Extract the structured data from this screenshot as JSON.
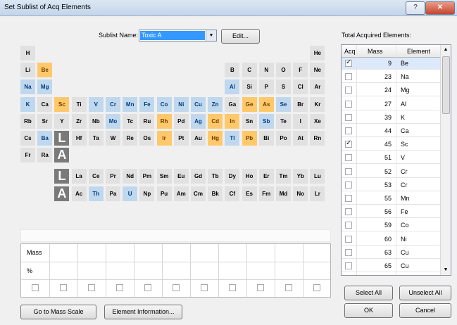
{
  "window": {
    "title": "Set Sublist of Acq Elements",
    "help": "?",
    "close": "✕"
  },
  "sublist": {
    "label": "Sublist Name:",
    "value": "Toxic A",
    "edit_button": "Edit..."
  },
  "total_label": "Total Acquired Elements:",
  "periodic_table": {
    "colors": {
      "normal": "#e1e1e1",
      "blue": "#c0d8ee",
      "orange": "#ffc96b",
      "gray": "#7a7a7a"
    },
    "elements": [
      {
        "s": "H",
        "r": 0,
        "c": 0,
        "k": "n"
      },
      {
        "s": "He",
        "r": 0,
        "c": 17,
        "k": "n"
      },
      {
        "s": "Li",
        "r": 1,
        "c": 0,
        "k": "n"
      },
      {
        "s": "Be",
        "r": 1,
        "c": 1,
        "k": "o"
      },
      {
        "s": "B",
        "r": 1,
        "c": 12,
        "k": "n"
      },
      {
        "s": "C",
        "r": 1,
        "c": 13,
        "k": "n"
      },
      {
        "s": "N",
        "r": 1,
        "c": 14,
        "k": "n"
      },
      {
        "s": "O",
        "r": 1,
        "c": 15,
        "k": "n"
      },
      {
        "s": "F",
        "r": 1,
        "c": 16,
        "k": "n"
      },
      {
        "s": "Ne",
        "r": 1,
        "c": 17,
        "k": "n"
      },
      {
        "s": "Na",
        "r": 2,
        "c": 0,
        "k": "b"
      },
      {
        "s": "Mg",
        "r": 2,
        "c": 1,
        "k": "b"
      },
      {
        "s": "Al",
        "r": 2,
        "c": 12,
        "k": "b"
      },
      {
        "s": "Si",
        "r": 2,
        "c": 13,
        "k": "n"
      },
      {
        "s": "P",
        "r": 2,
        "c": 14,
        "k": "n"
      },
      {
        "s": "S",
        "r": 2,
        "c": 15,
        "k": "n"
      },
      {
        "s": "Cl",
        "r": 2,
        "c": 16,
        "k": "n"
      },
      {
        "s": "Ar",
        "r": 2,
        "c": 17,
        "k": "n"
      },
      {
        "s": "K",
        "r": 3,
        "c": 0,
        "k": "b"
      },
      {
        "s": "Ca",
        "r": 3,
        "c": 1,
        "k": "n"
      },
      {
        "s": "Sc",
        "r": 3,
        "c": 2,
        "k": "o"
      },
      {
        "s": "Ti",
        "r": 3,
        "c": 3,
        "k": "n"
      },
      {
        "s": "V",
        "r": 3,
        "c": 4,
        "k": "b"
      },
      {
        "s": "Cr",
        "r": 3,
        "c": 5,
        "k": "b"
      },
      {
        "s": "Mn",
        "r": 3,
        "c": 6,
        "k": "b"
      },
      {
        "s": "Fe",
        "r": 3,
        "c": 7,
        "k": "b"
      },
      {
        "s": "Co",
        "r": 3,
        "c": 8,
        "k": "b"
      },
      {
        "s": "Ni",
        "r": 3,
        "c": 9,
        "k": "b"
      },
      {
        "s": "Cu",
        "r": 3,
        "c": 10,
        "k": "b"
      },
      {
        "s": "Zn",
        "r": 3,
        "c": 11,
        "k": "b"
      },
      {
        "s": "Ga",
        "r": 3,
        "c": 12,
        "k": "n"
      },
      {
        "s": "Ge",
        "r": 3,
        "c": 13,
        "k": "o"
      },
      {
        "s": "As",
        "r": 3,
        "c": 14,
        "k": "o"
      },
      {
        "s": "Se",
        "r": 3,
        "c": 15,
        "k": "b"
      },
      {
        "s": "Br",
        "r": 3,
        "c": 16,
        "k": "n"
      },
      {
        "s": "Kr",
        "r": 3,
        "c": 17,
        "k": "n"
      },
      {
        "s": "Rb",
        "r": 4,
        "c": 0,
        "k": "n"
      },
      {
        "s": "Sr",
        "r": 4,
        "c": 1,
        "k": "n"
      },
      {
        "s": "Y",
        "r": 4,
        "c": 2,
        "k": "n"
      },
      {
        "s": "Zr",
        "r": 4,
        "c": 3,
        "k": "n"
      },
      {
        "s": "Nb",
        "r": 4,
        "c": 4,
        "k": "n"
      },
      {
        "s": "Mo",
        "r": 4,
        "c": 5,
        "k": "b"
      },
      {
        "s": "Tc",
        "r": 4,
        "c": 6,
        "k": "n"
      },
      {
        "s": "Ru",
        "r": 4,
        "c": 7,
        "k": "n"
      },
      {
        "s": "Rh",
        "r": 4,
        "c": 8,
        "k": "o"
      },
      {
        "s": "Pd",
        "r": 4,
        "c": 9,
        "k": "n"
      },
      {
        "s": "Ag",
        "r": 4,
        "c": 10,
        "k": "b"
      },
      {
        "s": "Cd",
        "r": 4,
        "c": 11,
        "k": "o"
      },
      {
        "s": "In",
        "r": 4,
        "c": 12,
        "k": "o"
      },
      {
        "s": "Sn",
        "r": 4,
        "c": 13,
        "k": "n"
      },
      {
        "s": "Sb",
        "r": 4,
        "c": 14,
        "k": "b"
      },
      {
        "s": "Te",
        "r": 4,
        "c": 15,
        "k": "n"
      },
      {
        "s": "I",
        "r": 4,
        "c": 16,
        "k": "n"
      },
      {
        "s": "Xe",
        "r": 4,
        "c": 17,
        "k": "n"
      },
      {
        "s": "Cs",
        "r": 5,
        "c": 0,
        "k": "n"
      },
      {
        "s": "Ba",
        "r": 5,
        "c": 1,
        "k": "b"
      },
      {
        "s": "L",
        "r": 5,
        "c": 2,
        "k": "g"
      },
      {
        "s": "Hf",
        "r": 5,
        "c": 3,
        "k": "n"
      },
      {
        "s": "Ta",
        "r": 5,
        "c": 4,
        "k": "n"
      },
      {
        "s": "W",
        "r": 5,
        "c": 5,
        "k": "n"
      },
      {
        "s": "Re",
        "r": 5,
        "c": 6,
        "k": "n"
      },
      {
        "s": "Os",
        "r": 5,
        "c": 7,
        "k": "n"
      },
      {
        "s": "Ir",
        "r": 5,
        "c": 8,
        "k": "o"
      },
      {
        "s": "Pt",
        "r": 5,
        "c": 9,
        "k": "n"
      },
      {
        "s": "Au",
        "r": 5,
        "c": 10,
        "k": "n"
      },
      {
        "s": "Hg",
        "r": 5,
        "c": 11,
        "k": "o"
      },
      {
        "s": "Tl",
        "r": 5,
        "c": 12,
        "k": "b"
      },
      {
        "s": "Pb",
        "r": 5,
        "c": 13,
        "k": "o"
      },
      {
        "s": "Bi",
        "r": 5,
        "c": 14,
        "k": "n"
      },
      {
        "s": "Po",
        "r": 5,
        "c": 15,
        "k": "n"
      },
      {
        "s": "At",
        "r": 5,
        "c": 16,
        "k": "n"
      },
      {
        "s": "Rn",
        "r": 5,
        "c": 17,
        "k": "n"
      },
      {
        "s": "Fr",
        "r": 6,
        "c": 0,
        "k": "n"
      },
      {
        "s": "Ra",
        "r": 6,
        "c": 1,
        "k": "n"
      },
      {
        "s": "A",
        "r": 6,
        "c": 2,
        "k": "g"
      },
      {
        "s": "L",
        "r": 7,
        "c": 2,
        "k": "g"
      },
      {
        "s": "La",
        "r": 7,
        "c": 3,
        "k": "n"
      },
      {
        "s": "Ce",
        "r": 7,
        "c": 4,
        "k": "n"
      },
      {
        "s": "Pr",
        "r": 7,
        "c": 5,
        "k": "n"
      },
      {
        "s": "Nd",
        "r": 7,
        "c": 6,
        "k": "n"
      },
      {
        "s": "Pm",
        "r": 7,
        "c": 7,
        "k": "n"
      },
      {
        "s": "Sm",
        "r": 7,
        "c": 8,
        "k": "n"
      },
      {
        "s": "Eu",
        "r": 7,
        "c": 9,
        "k": "n"
      },
      {
        "s": "Gd",
        "r": 7,
        "c": 10,
        "k": "n"
      },
      {
        "s": "Tb",
        "r": 7,
        "c": 11,
        "k": "n"
      },
      {
        "s": "Dy",
        "r": 7,
        "c": 12,
        "k": "n"
      },
      {
        "s": "Ho",
        "r": 7,
        "c": 13,
        "k": "n"
      },
      {
        "s": "Er",
        "r": 7,
        "c": 14,
        "k": "n"
      },
      {
        "s": "Tm",
        "r": 7,
        "c": 15,
        "k": "n"
      },
      {
        "s": "Yb",
        "r": 7,
        "c": 16,
        "k": "n"
      },
      {
        "s": "Lu",
        "r": 7,
        "c": 17,
        "k": "n"
      },
      {
        "s": "A",
        "r": 8,
        "c": 2,
        "k": "g"
      },
      {
        "s": "Ac",
        "r": 8,
        "c": 3,
        "k": "n"
      },
      {
        "s": "Th",
        "r": 8,
        "c": 4,
        "k": "b"
      },
      {
        "s": "Pa",
        "r": 8,
        "c": 5,
        "k": "n"
      },
      {
        "s": "U",
        "r": 8,
        "c": 6,
        "k": "b"
      },
      {
        "s": "Np",
        "r": 8,
        "c": 7,
        "k": "n"
      },
      {
        "s": "Pu",
        "r": 8,
        "c": 8,
        "k": "n"
      },
      {
        "s": "Am",
        "r": 8,
        "c": 9,
        "k": "n"
      },
      {
        "s": "Cm",
        "r": 8,
        "c": 10,
        "k": "n"
      },
      {
        "s": "Bk",
        "r": 8,
        "c": 11,
        "k": "n"
      },
      {
        "s": "Cf",
        "r": 8,
        "c": 12,
        "k": "n"
      },
      {
        "s": "Es",
        "r": 8,
        "c": 13,
        "k": "n"
      },
      {
        "s": "Fm",
        "r": 8,
        "c": 14,
        "k": "n"
      },
      {
        "s": "Md",
        "r": 8,
        "c": 15,
        "k": "n"
      },
      {
        "s": "No",
        "r": 8,
        "c": 16,
        "k": "n"
      },
      {
        "s": "Lr",
        "r": 8,
        "c": 17,
        "k": "n"
      }
    ]
  },
  "mass_grid": {
    "row_labels": [
      "Mass",
      "%"
    ]
  },
  "list": {
    "headers": [
      "Acq",
      "Mass",
      "Element"
    ],
    "rows": [
      {
        "checked": true,
        "mass": "9",
        "element": "Be",
        "selected": true
      },
      {
        "checked": false,
        "mass": "23",
        "element": "Na"
      },
      {
        "checked": false,
        "mass": "24",
        "element": "Mg"
      },
      {
        "checked": false,
        "mass": "27",
        "element": "Al"
      },
      {
        "checked": false,
        "mass": "39",
        "element": "K"
      },
      {
        "checked": false,
        "mass": "44",
        "element": "Ca"
      },
      {
        "checked": true,
        "mass": "45",
        "element": "Sc"
      },
      {
        "checked": false,
        "mass": "51",
        "element": "V"
      },
      {
        "checked": false,
        "mass": "52",
        "element": "Cr"
      },
      {
        "checked": false,
        "mass": "53",
        "element": "Cr"
      },
      {
        "checked": false,
        "mass": "55",
        "element": "Mn"
      },
      {
        "checked": false,
        "mass": "56",
        "element": "Fe"
      },
      {
        "checked": false,
        "mass": "59",
        "element": "Co"
      },
      {
        "checked": false,
        "mass": "60",
        "element": "Ni"
      },
      {
        "checked": false,
        "mass": "63",
        "element": "Cu"
      },
      {
        "checked": false,
        "mass": "65",
        "element": "Cu"
      }
    ]
  },
  "buttons": {
    "select_all": "Select All",
    "unselect_all": "Unselect All",
    "ok": "OK",
    "cancel": "Cancel",
    "mass_scale": "Go to Mass Scale",
    "element_info": "Element Information..."
  }
}
